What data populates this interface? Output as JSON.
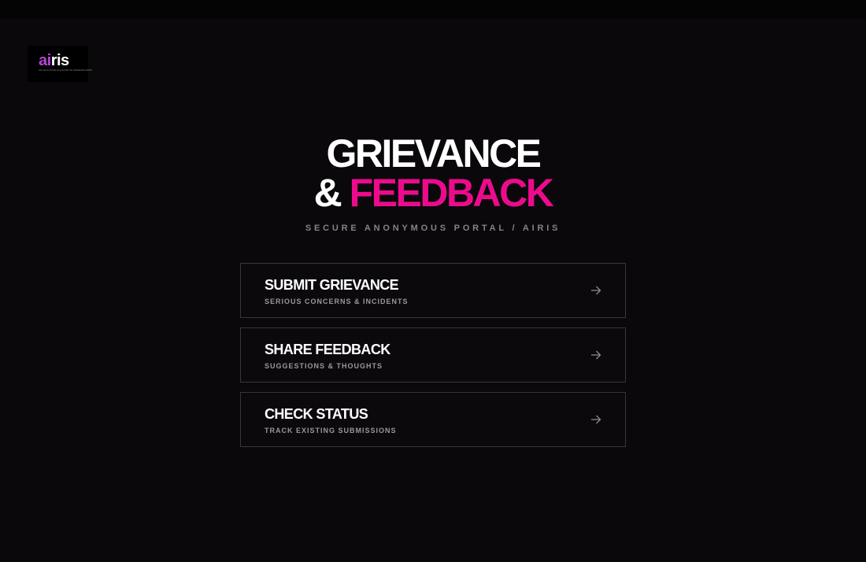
{
  "logo": {
    "part_ai": "ai",
    "part_ris": "ris",
    "tagline": "AN INCLUSIVE ALLIANCE OF RESEARCHERS"
  },
  "hero": {
    "title_line1": "GRIEVANCE",
    "title_amp": "& ",
    "title_accent": "FEEDBACK",
    "subtitle": "SECURE ANONYMOUS PORTAL / AIRIS"
  },
  "menu": {
    "items": [
      {
        "title": "SUBMIT GRIEVANCE",
        "subtitle": "SERIOUS CONCERNS & INCIDENTS",
        "icon": "arrow-right-icon"
      },
      {
        "title": "SHARE FEEDBACK",
        "subtitle": "SUGGESTIONS & THOUGHTS",
        "icon": "arrow-right-icon"
      },
      {
        "title": "CHECK STATUS",
        "subtitle": "TRACK EXISTING SUBMISSIONS",
        "icon": "arrow-right-icon"
      }
    ]
  },
  "colors": {
    "background": "#0a080b",
    "accent": "#ec0b8c",
    "logo_accent": "#b542d6",
    "card_border": "#38363b",
    "muted_text": "#85838a"
  }
}
